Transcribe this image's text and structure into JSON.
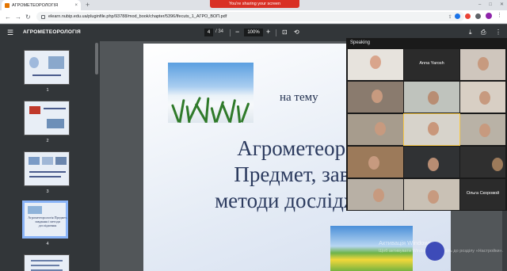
{
  "browser": {
    "tab_title": "АГРОМЕТЕОРОЛОГІЯ",
    "tab_close": "×",
    "new_tab": "+",
    "share_banner": "You're sharing your screen",
    "url": "elearn.nubip.edu.ua/pluginfile.php/93788/mod_book/chapter/5396/lfecuts_1_АГРО_ВОП.pdf",
    "win_minimize": "–",
    "win_maximize": "□",
    "win_close": "✕",
    "back": "←",
    "forward": "→",
    "reload": "↻",
    "share_icon": "⇪",
    "star_icon": "☆",
    "kebab": "⋮"
  },
  "pdf_toolbar": {
    "menu_icon": "☰",
    "title": "АГРОМЕТЕОРОЛОГІЯ",
    "current_page": "4",
    "total_pages": "/ 34",
    "zoom_minus": "−",
    "zoom": "100%",
    "zoom_plus": "+",
    "fit_icon": "⊡",
    "rotate_icon": "⟲",
    "download_icon": "⤓",
    "print_icon": "⎙",
    "more_icon": "⋮"
  },
  "thumbnails": [
    {
      "num": "1"
    },
    {
      "num": "2"
    },
    {
      "num": "3"
    },
    {
      "num": "4",
      "text": "Агрометеорологія Предмет, завдання і методи дослідження"
    }
  ],
  "slide": {
    "subtitle": "на тему",
    "title_line1": "Агрометеорол",
    "title_line2": "Предмет, завда",
    "title_line3": "методи досліджень"
  },
  "windows_watermark": {
    "line1": "Активація Windows",
    "line2": "Щоб активувати Windows, перейдіть до розділу «Настройки»."
  },
  "zoom_gallery": {
    "speaking_label": "Speaking",
    "participants": [
      {
        "name": ""
      },
      {
        "name": "Anna Yarosh"
      },
      {
        "name": ""
      },
      {
        "name": ""
      },
      {
        "name": ""
      },
      {
        "name": ""
      },
      {
        "name": ""
      },
      {
        "name": ""
      },
      {
        "name": ""
      },
      {
        "name": ""
      },
      {
        "name": ""
      },
      {
        "name": ""
      },
      {
        "name": ""
      },
      {
        "name": ""
      },
      {
        "name": "Ольга Скоровой"
      }
    ]
  },
  "colors": {
    "toolbar": "#323639",
    "share_banner": "#d93025",
    "selected_thumb": "#8ab4f8",
    "slide_text": "#2b3a5e"
  }
}
